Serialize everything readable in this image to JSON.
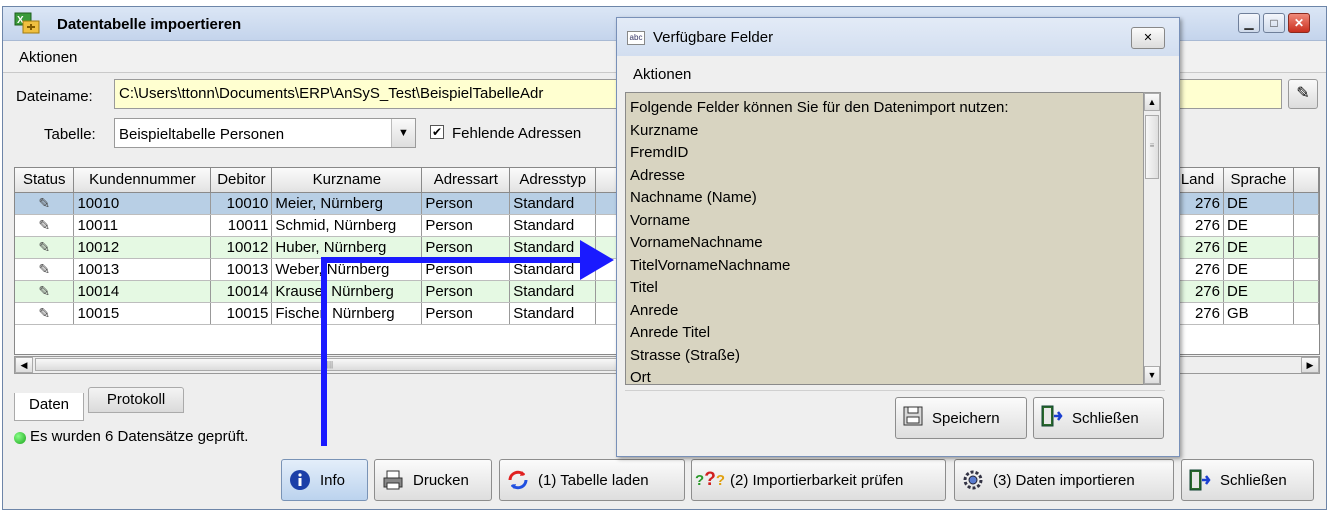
{
  "window": {
    "title": "Datentabelle impoertieren",
    "menu": "Aktionen",
    "controls": [
      "minimize-icon",
      "maximize-icon",
      "close-icon"
    ]
  },
  "file": {
    "label": "Dateiname:",
    "value": "C:\\Users\\ttonn\\Documents\\ERP\\AnSyS_Test\\BeispielTabelleAdr"
  },
  "table_select": {
    "label": "Tabelle:",
    "value": "Beispieltabelle Personen"
  },
  "checkbox": {
    "label": "Fehlende Adressen",
    "checked": true
  },
  "grid": {
    "headers": [
      "Status",
      "Kundennummer",
      "Debitor",
      "Kurzname",
      "Adressart",
      "Adresstyp",
      "Land",
      "Sprache"
    ],
    "rows": [
      {
        "knr": "10010",
        "deb": "10010",
        "kurz": "Meier, Nürnberg",
        "art": "Person",
        "typ": "Standard",
        "land": "276",
        "spr": "DE",
        "style": "sel"
      },
      {
        "knr": "10011",
        "deb": "10011",
        "kurz": "Schmid, Nürnberg",
        "art": "Person",
        "typ": "Standard",
        "land": "276",
        "spr": "DE",
        "style": "plain"
      },
      {
        "knr": "10012",
        "deb": "10012",
        "kurz": "Huber, Nürnberg",
        "art": "Person",
        "typ": "Standard",
        "land": "276",
        "spr": "DE",
        "style": "green"
      },
      {
        "knr": "10013",
        "deb": "10013",
        "kurz": "Weber, Nürnberg",
        "art": "Person",
        "typ": "Standard",
        "land": "276",
        "spr": "DE",
        "style": "plain"
      },
      {
        "knr": "10014",
        "deb": "10014",
        "kurz": "Krause, Nürnberg",
        "art": "Person",
        "typ": "Standard",
        "land": "276",
        "spr": "DE",
        "style": "green"
      },
      {
        "knr": "10015",
        "deb": "10015",
        "kurz": "Fischer, Nürnberg",
        "art": "Person",
        "typ": "Standard",
        "land": "276",
        "spr": "GB",
        "style": "plain"
      }
    ]
  },
  "tabs": [
    "Daten",
    "Protokoll"
  ],
  "status": "Es wurden 6 Datensätze geprüft.",
  "buttons": {
    "info": "Info",
    "print": "Drucken",
    "load": "(1) Tabelle laden",
    "check": "(2) Importierbarkeit prüfen",
    "import": "(3) Daten importieren",
    "close": "Schließen"
  },
  "dialog": {
    "title": "Verfügbare Felder",
    "menu": "Aktionen",
    "intro": "Folgende Felder können Sie für den Datenimport nutzen:",
    "fields": [
      "Kurzname",
      "FremdID",
      "Adresse",
      "Nachname (Name)",
      "Vorname",
      "VornameNachname",
      "TitelVornameNachname",
      "Titel",
      "Anrede",
      "Anrede Titel",
      "Strasse (Straße)",
      "Ort"
    ],
    "save": "Speichern",
    "close": "Schließen"
  },
  "colors": {
    "accent_arrow": "#1a1aff",
    "selected_row": "#b8cfe5",
    "green_row": "#e5f9e3",
    "file_bg": "#ffffd0",
    "text_area": "#d8d4c1"
  }
}
